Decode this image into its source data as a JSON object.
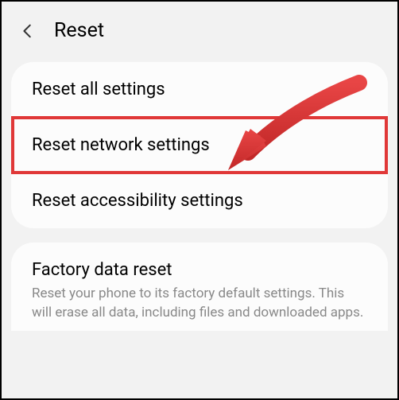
{
  "header": {
    "title": "Reset"
  },
  "items": [
    {
      "label": "Reset all settings"
    },
    {
      "label": "Reset network settings"
    },
    {
      "label": "Reset accessibility settings"
    }
  ],
  "factory": {
    "label": "Factory data reset",
    "desc": "Reset your phone to its factory default settings. This will erase all data, including files and downloaded apps."
  },
  "annotation": {
    "highlight_color": "#e03838",
    "arrow_color": "#d83434"
  }
}
